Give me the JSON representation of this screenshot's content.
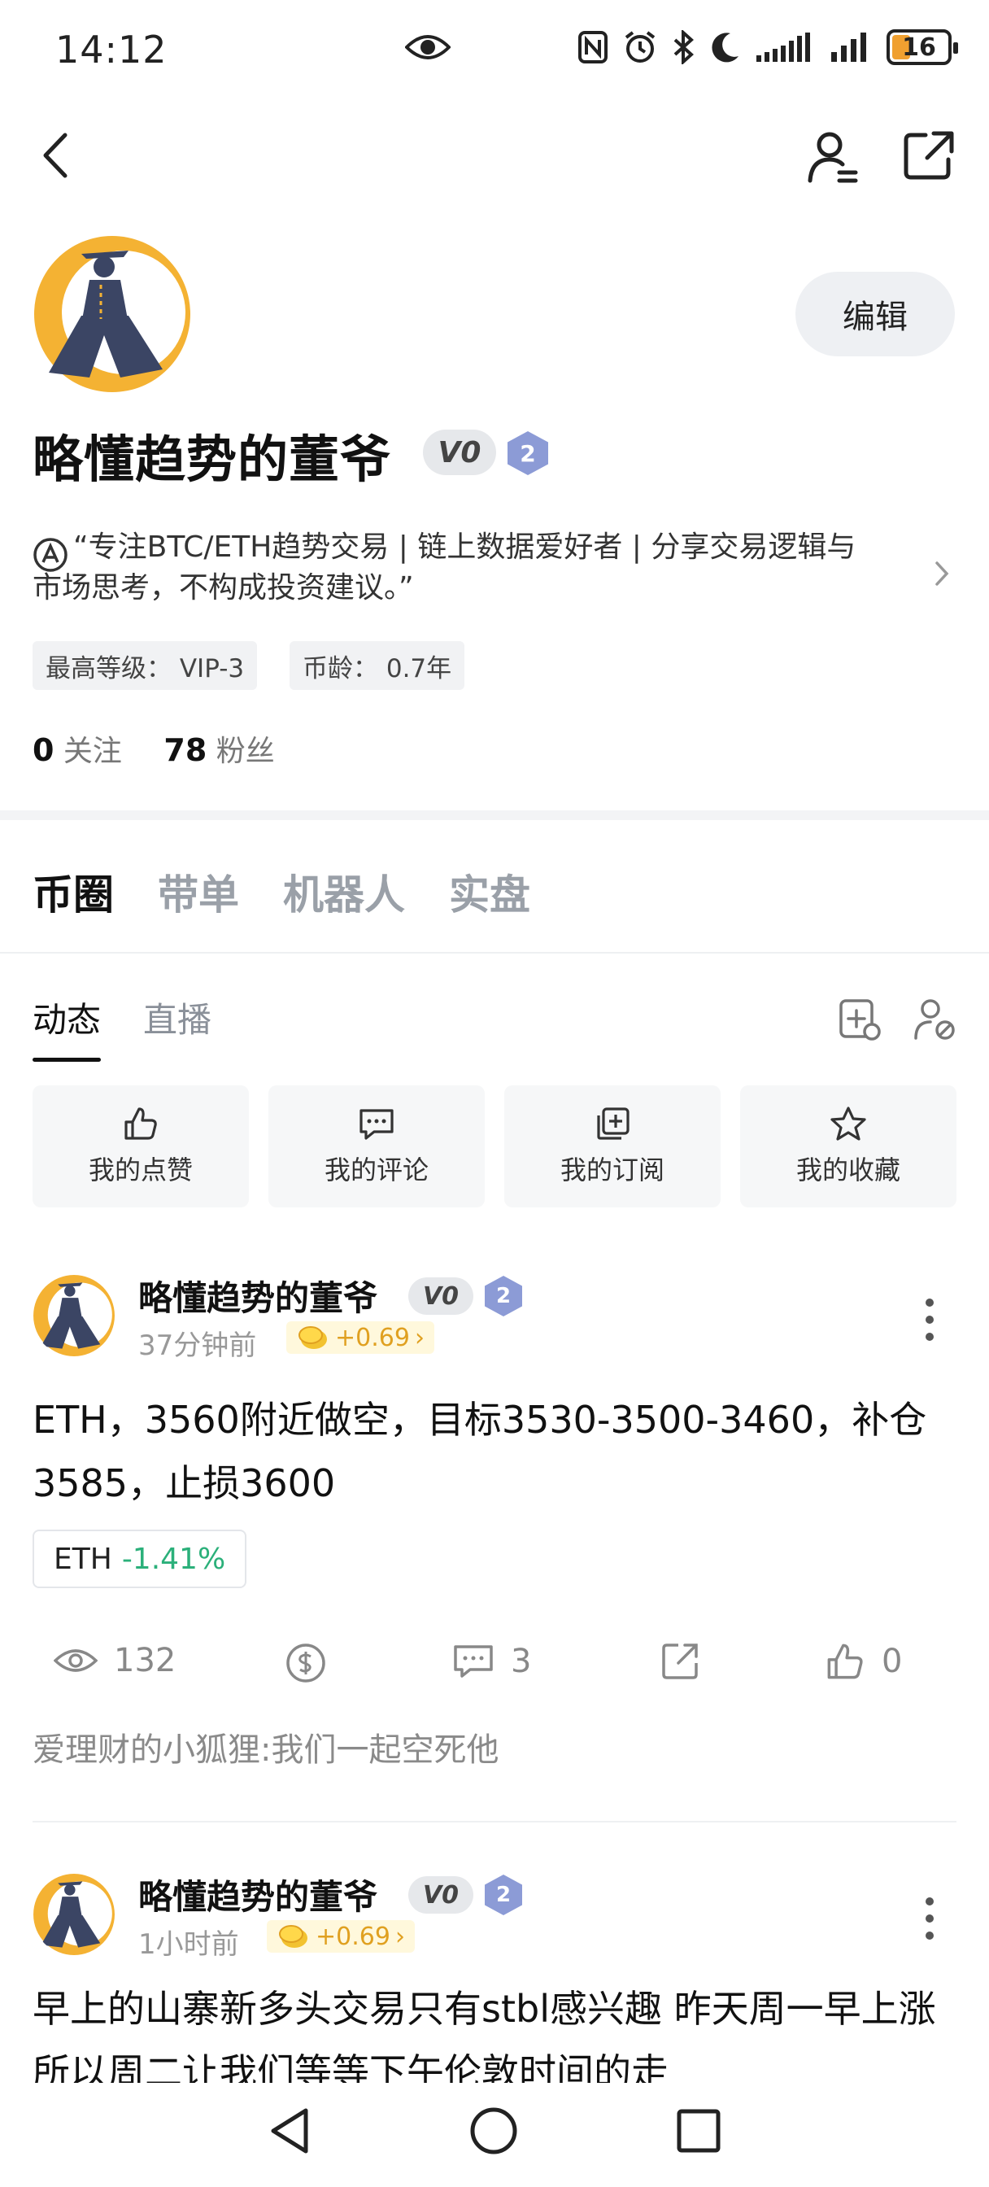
{
  "status_bar": {
    "time": "14:12",
    "battery": "16"
  },
  "profile": {
    "name": "略懂趋势的董爷",
    "vip_badge": "V0",
    "level": "2",
    "edit_label": "编辑",
    "bio": "“专注BTC/ETH趋势交易 | 链上数据爱好者 | 分享交易逻辑与市场思考，不构成投资建议。”",
    "tags": [
      "最高等级：  VIP-3",
      "币龄：  0.7年"
    ],
    "following_count": "0",
    "following_label": "关注",
    "followers_count": "78",
    "followers_label": "粉丝"
  },
  "main_tabs": [
    "币圈",
    "带单",
    "机器人",
    "实盘"
  ],
  "sub_tabs": [
    "动态",
    "直播"
  ],
  "quick_actions": [
    {
      "label": "我的点赞",
      "icon": "thumbs-up-icon"
    },
    {
      "label": "我的评论",
      "icon": "comment-icon"
    },
    {
      "label": "我的订阅",
      "icon": "subscribe-icon"
    },
    {
      "label": "我的收藏",
      "icon": "star-icon"
    }
  ],
  "posts": [
    {
      "author": "略懂趋势的董爷",
      "vip": "V0",
      "level": "2",
      "time": "37分钟前",
      "coin": "+0.69",
      "content": "ETH，3560附近做空，目标3530-3500-3460，补仓3585，止损3600",
      "ticker": "ETH",
      "ticker_change": "-1.41%",
      "views": "132",
      "comments": "3",
      "likes": "0",
      "comment_preview": "爱理财的小狐狸:我们一起空死他"
    },
    {
      "author": "略懂趋势的董爷",
      "vip": "V0",
      "level": "2",
      "time": "1小时前",
      "coin": "+0.69",
      "content": "早上的山寨新多头交易只有stbl感兴趣  昨天周一早上涨  所以周二让我们等等下午伦敦时间的走"
    }
  ],
  "colors": {
    "accent_green": "#2bb07a",
    "coin_gold": "#e0a020",
    "level_badge": "#8c9bd6"
  }
}
